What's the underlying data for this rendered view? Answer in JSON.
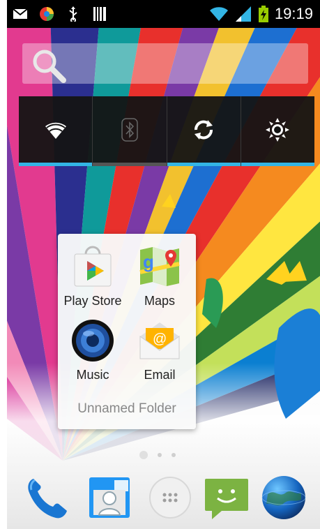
{
  "status_bar": {
    "left_icons": [
      "mail-icon",
      "browser-icon",
      "usb-icon",
      "barcode-icon"
    ],
    "right_icons": [
      "wifi-icon",
      "signal-icon",
      "battery-charging-icon"
    ],
    "time": "19:19"
  },
  "search_widget": {
    "icon": "search-icon"
  },
  "power_widget": {
    "toggles": [
      {
        "name": "wifi",
        "icon": "wifi-icon",
        "state": "on"
      },
      {
        "name": "bluetooth",
        "icon": "bluetooth-icon",
        "state": "off"
      },
      {
        "name": "sync",
        "icon": "sync-icon",
        "state": "on"
      },
      {
        "name": "brightness",
        "icon": "brightness-icon",
        "state": "on"
      }
    ],
    "on_color": "#33b5e5",
    "off_color": "#555555"
  },
  "folder": {
    "name": "Unnamed Folder",
    "apps": [
      {
        "label": "Play Store",
        "icon": "play-store-icon"
      },
      {
        "label": "Maps",
        "icon": "maps-icon"
      },
      {
        "label": "Music",
        "icon": "music-icon"
      },
      {
        "label": "Email",
        "icon": "email-icon"
      }
    ]
  },
  "page_indicator": {
    "pages": 3,
    "current": 1
  },
  "dock": {
    "items": [
      {
        "icon": "phone-icon"
      },
      {
        "icon": "contacts-icon"
      },
      {
        "icon": "app-drawer-icon"
      },
      {
        "icon": "messaging-icon"
      },
      {
        "icon": "browser-globe-icon"
      }
    ]
  }
}
